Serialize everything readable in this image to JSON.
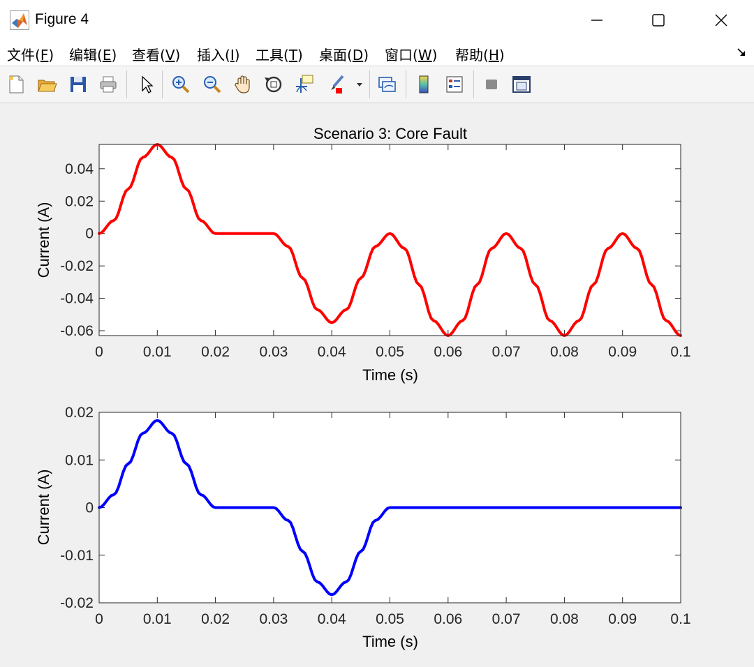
{
  "window": {
    "title": "Figure 4"
  },
  "menu": {
    "items": [
      {
        "label": "文件(",
        "key": "F",
        "close": ")"
      },
      {
        "label": "编辑(",
        "key": "E",
        "close": ")"
      },
      {
        "label": "查看(",
        "key": "V",
        "close": ")"
      },
      {
        "label": "插入(",
        "key": "I",
        "close": ")"
      },
      {
        "label": "工具(",
        "key": "T",
        "close": ")"
      },
      {
        "label": "桌面(",
        "key": "D",
        "close": ")"
      },
      {
        "label": "窗口(",
        "key": "W",
        "close": ")"
      },
      {
        "label": "帮助(",
        "key": "H",
        "close": ")"
      }
    ]
  },
  "toolbar": {
    "tools": [
      "new-figure-icon",
      "open-file-icon",
      "save-icon",
      "print-icon",
      "edit-plot-arrow-icon",
      "zoom-in-icon",
      "zoom-out-icon",
      "pan-hand-icon",
      "rotate-3d-icon",
      "data-cursor-icon",
      "brush-icon",
      "brush-dropdown-icon",
      "link-plot-icon",
      "colorbar-icon",
      "legend-icon",
      "hide-plot-tools-icon",
      "show-plot-tools-icon"
    ]
  },
  "colors": {
    "series_top": "#ff0000",
    "series_bottom": "#0000ff"
  },
  "chart_data": [
    {
      "type": "line",
      "title": "Scenario 3: Core Fault",
      "xlabel": "Time (s)",
      "ylabel": "Current (A)",
      "xlim": [
        0,
        0.1
      ],
      "ylim": [
        -0.063,
        0.055
      ],
      "xticks": [
        "0",
        "0.01",
        "0.02",
        "0.03",
        "0.04",
        "0.05",
        "0.06",
        "0.07",
        "0.08",
        "0.09",
        "0.1"
      ],
      "yticks": [
        {
          "value": 0.04,
          "label": "0.04"
        },
        {
          "value": 0.02,
          "label": "0.02"
        },
        {
          "value": 0,
          "label": "0"
        },
        {
          "value": -0.02,
          "label": "-0.02"
        },
        {
          "value": -0.04,
          "label": "-0.04"
        },
        {
          "value": -0.06,
          "label": "-0.06"
        }
      ],
      "series": [
        {
          "x": [
            0,
            0.0025,
            0.005,
            0.0075,
            0.01,
            0.0125,
            0.015,
            0.0175,
            0.02,
            0.025,
            0.03,
            0.0325,
            0.035,
            0.0375,
            0.04,
            0.0425,
            0.045,
            0.0475,
            0.05,
            0.0525,
            0.055,
            0.0575,
            0.06,
            0.0625,
            0.065,
            0.0675,
            0.07,
            0.0725,
            0.075,
            0.0775,
            0.08,
            0.0825,
            0.085,
            0.0875,
            0.09,
            0.0925,
            0.095,
            0.0975,
            0.1
          ],
          "y": [
            0,
            0.008,
            0.0275,
            0.047,
            0.055,
            0.047,
            0.0275,
            0.008,
            0,
            0,
            0,
            -0.008,
            -0.0275,
            -0.047,
            -0.055,
            -0.047,
            -0.0275,
            -0.008,
            0,
            -0.0092,
            -0.0315,
            -0.0538,
            -0.063,
            -0.0538,
            -0.0315,
            -0.0092,
            0,
            -0.0092,
            -0.0315,
            -0.0538,
            -0.063,
            -0.0538,
            -0.0315,
            -0.0092,
            0,
            -0.0092,
            -0.0315,
            -0.0538,
            -0.063
          ]
        }
      ]
    },
    {
      "type": "line",
      "title": "",
      "xlabel": "Time (s)",
      "ylabel": "Current (A)",
      "xlim": [
        0,
        0.1
      ],
      "ylim": [
        -0.02,
        0.02
      ],
      "xticks": [
        "0",
        "0.01",
        "0.02",
        "0.03",
        "0.04",
        "0.05",
        "0.06",
        "0.07",
        "0.08",
        "0.09",
        "0.1"
      ],
      "yticks": [
        {
          "value": 0.02,
          "label": "0.02"
        },
        {
          "value": 0.01,
          "label": "0.01"
        },
        {
          "value": 0,
          "label": "0"
        },
        {
          "value": -0.01,
          "label": "-0.01"
        },
        {
          "value": -0.02,
          "label": "-0.02"
        }
      ],
      "series": [
        {
          "x": [
            0,
            0.0025,
            0.005,
            0.0075,
            0.01,
            0.0125,
            0.015,
            0.0175,
            0.02,
            0.025,
            0.03,
            0.0325,
            0.035,
            0.0375,
            0.04,
            0.0425,
            0.045,
            0.0475,
            0.05,
            0.06,
            0.07,
            0.08,
            0.09,
            0.1
          ],
          "y": [
            0,
            0.0027,
            0.0092,
            0.0156,
            0.0183,
            0.0156,
            0.0092,
            0.0027,
            0,
            0,
            0,
            -0.0027,
            -0.0092,
            -0.0156,
            -0.0183,
            -0.0156,
            -0.0092,
            -0.0027,
            0,
            0,
            0,
            0,
            0,
            0
          ]
        }
      ]
    }
  ]
}
